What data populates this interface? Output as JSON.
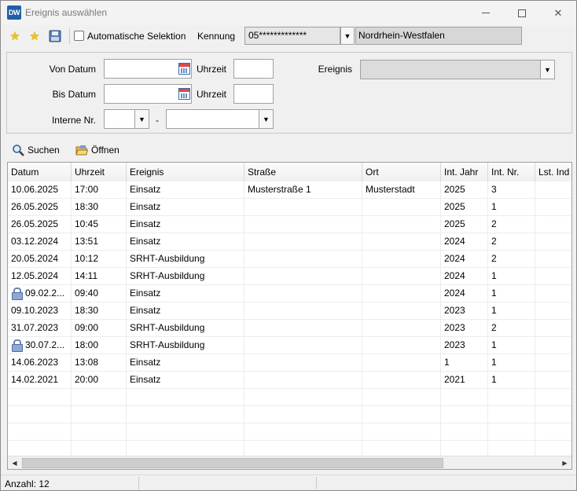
{
  "window": {
    "app_icon_text": "DW",
    "title": "Ereignis auswählen"
  },
  "toolbar": {
    "auto_selection_label": "Automatische Selektion",
    "auto_selection_checked": false,
    "kennung_label": "Kennung",
    "kennung_value": "05*************",
    "state_value": "Nordrhein-Westfalen"
  },
  "filter": {
    "von_datum_label": "Von Datum",
    "bis_datum_label": "Bis Datum",
    "uhrzeit_label": "Uhrzeit",
    "interne_nr_label": "Interne Nr.",
    "dash": "-",
    "ereignis_label": "Ereignis",
    "von_datum_value": "",
    "bis_datum_value": "",
    "von_uhrzeit_value": "",
    "bis_uhrzeit_value": "",
    "ereignis_value": ""
  },
  "actions": {
    "search_label": "Suchen",
    "open_label": "Öffnen"
  },
  "table": {
    "columns": [
      "Datum",
      "Uhrzeit",
      "Ereignis",
      "Straße",
      "Ort",
      "Int. Jahr",
      "Int. Nr.",
      "Lst. Ind"
    ],
    "rows": [
      {
        "locked": false,
        "cells": [
          "10.06.2025",
          "17:00",
          "Einsatz",
          "Musterstraße 1",
          "Musterstadt",
          "2025",
          "3",
          ""
        ]
      },
      {
        "locked": false,
        "cells": [
          "26.05.2025",
          "18:30",
          "Einsatz",
          "",
          "",
          "2025",
          "1",
          ""
        ]
      },
      {
        "locked": false,
        "cells": [
          "26.05.2025",
          "10:45",
          "Einsatz",
          "",
          "",
          "2025",
          "2",
          ""
        ]
      },
      {
        "locked": false,
        "cells": [
          "03.12.2024",
          "13:51",
          "Einsatz",
          "",
          "",
          "2024",
          "2",
          ""
        ]
      },
      {
        "locked": false,
        "cells": [
          "20.05.2024",
          "10:12",
          "SRHT-Ausbildung",
          "",
          "",
          "2024",
          "2",
          ""
        ]
      },
      {
        "locked": false,
        "cells": [
          "12.05.2024",
          "14:11",
          "SRHT-Ausbildung",
          "",
          "",
          "2024",
          "1",
          ""
        ]
      },
      {
        "locked": true,
        "cells": [
          "09.02.2...",
          "09:40",
          "Einsatz",
          "",
          "",
          "2024",
          "1",
          ""
        ]
      },
      {
        "locked": false,
        "cells": [
          "09.10.2023",
          "18:30",
          "Einsatz",
          "",
          "",
          "2023",
          "1",
          ""
        ]
      },
      {
        "locked": false,
        "cells": [
          "31.07.2023",
          "09:00",
          "SRHT-Ausbildung",
          "",
          "",
          "2023",
          "2",
          ""
        ]
      },
      {
        "locked": true,
        "cells": [
          "30.07.2...",
          "18:00",
          "SRHT-Ausbildung",
          "",
          "",
          "2023",
          "1",
          ""
        ]
      },
      {
        "locked": false,
        "cells": [
          "14.06.2023",
          "13:08",
          "Einsatz",
          "",
          "",
          "1",
          "1",
          ""
        ]
      },
      {
        "locked": false,
        "cells": [
          "14.02.2021",
          "20:00",
          "Einsatz",
          "",
          "",
          "2021",
          "1",
          ""
        ]
      }
    ],
    "empty_rows": 5
  },
  "status": {
    "count_text": "Anzahl: 12"
  },
  "icons": {
    "favorite_add": "star-plus-icon",
    "favorite_manage": "star-gear-icon",
    "save": "disk-icon",
    "calendar": "calendar-icon",
    "search": "magnifier-icon",
    "open": "folder-open-icon",
    "lock": "lock-icon"
  }
}
